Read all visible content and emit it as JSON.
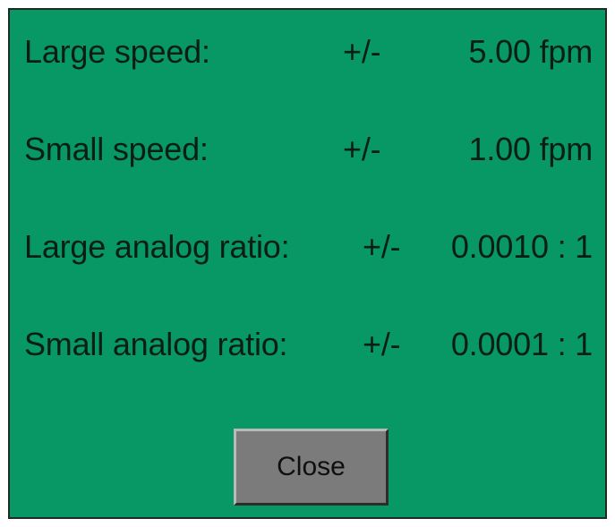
{
  "settings": [
    {
      "label": "Large speed:",
      "plusminus": "+/-",
      "value": "5.00 fpm"
    },
    {
      "label": "Small speed:",
      "plusminus": "+/-",
      "value": "1.00 fpm"
    },
    {
      "label": "Large analog ratio:",
      "plusminus": "+/-",
      "value": "0.0010 : 1"
    },
    {
      "label": "Small analog ratio:",
      "plusminus": "+/-",
      "value": "0.0001 : 1"
    }
  ],
  "buttons": {
    "close_label": "Close"
  },
  "colors": {
    "panel_background": "#079866",
    "button_background": "#7b7b7b",
    "text": "#0b1e16"
  }
}
